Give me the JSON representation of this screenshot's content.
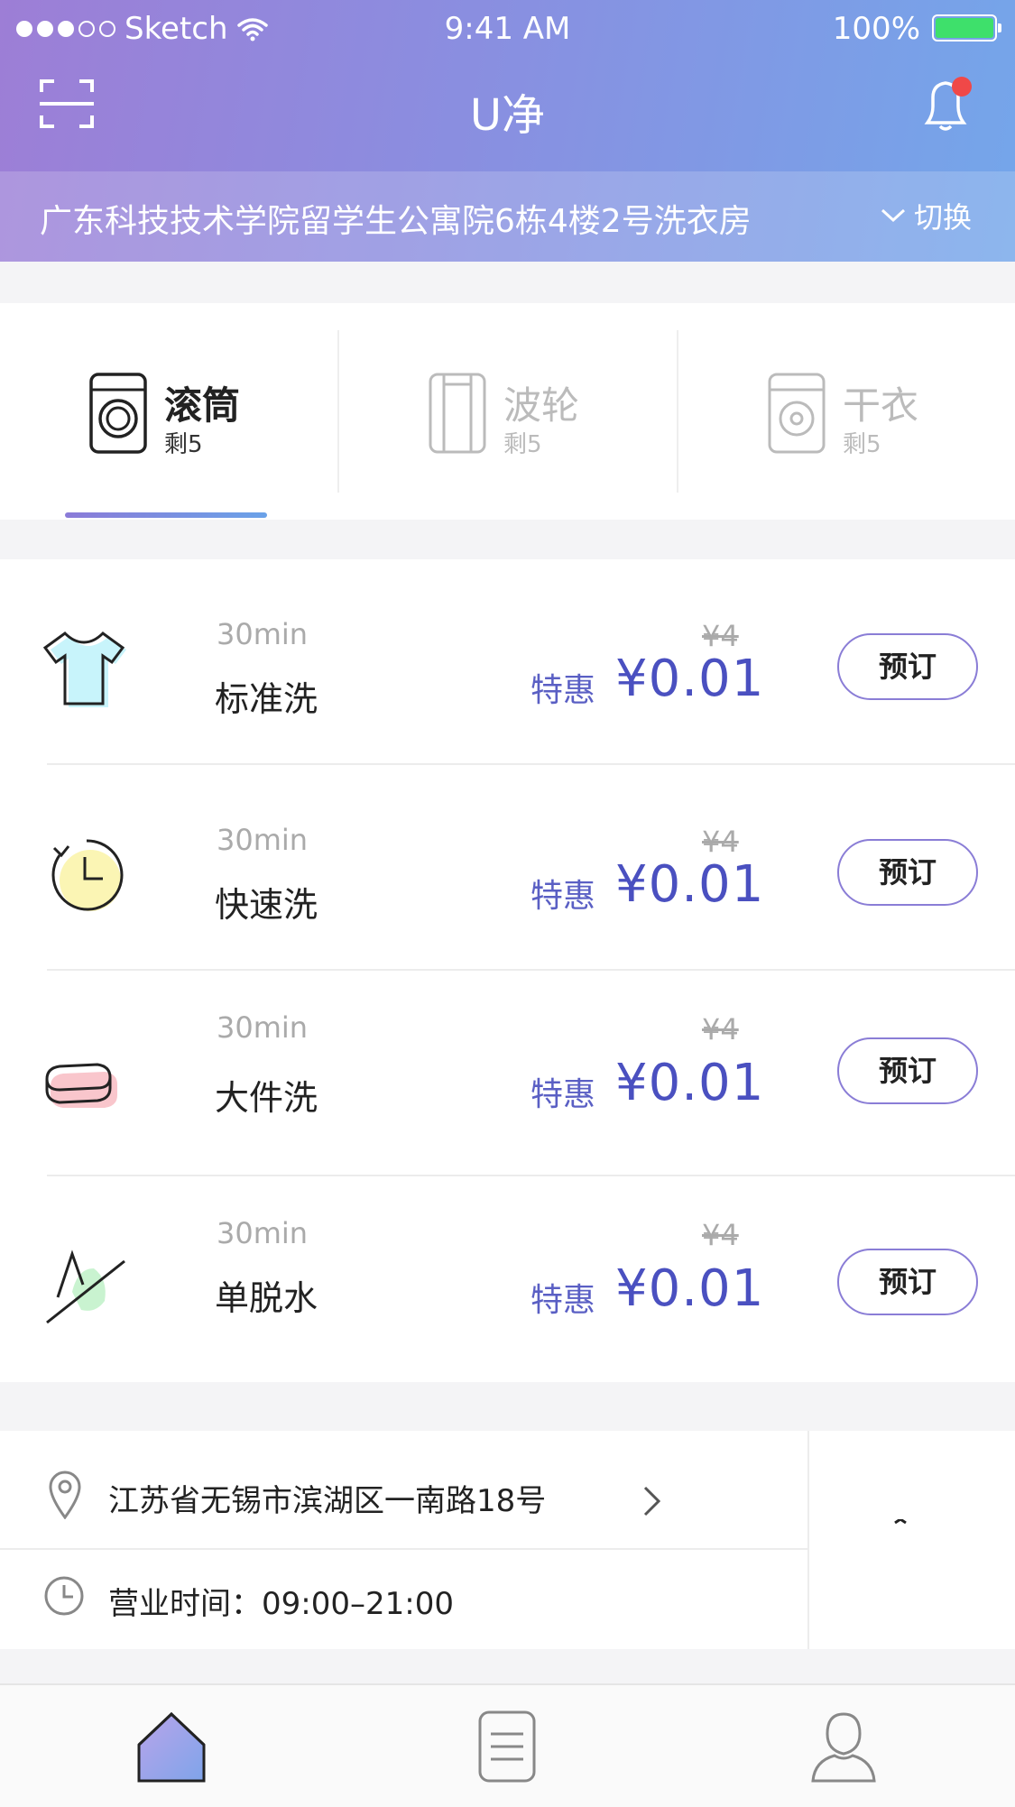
{
  "status_bar": {
    "carrier": "Sketch",
    "time": "9:41 AM",
    "battery": "100%"
  },
  "nav": {
    "title": "U净",
    "scan_icon": "scan-icon",
    "bell_icon": "bell-icon",
    "badge_color": "#f04848"
  },
  "location": {
    "address": "广东科技技术学院留学生公寓院6栋4楼2号洗衣房",
    "switch_label": "切换"
  },
  "machine_tabs": [
    {
      "name": "滚筒",
      "remaining": "剩5",
      "active": true
    },
    {
      "name": "波轮",
      "remaining": "剩5",
      "active": false
    },
    {
      "name": "干衣",
      "remaining": "剩5",
      "active": false
    }
  ],
  "services": [
    {
      "duration": "30min",
      "name": "标准洗",
      "original_price": "¥4",
      "deal_label": "特惠",
      "price": "¥0.01",
      "book_label": "预订",
      "icon": "tshirt-icon"
    },
    {
      "duration": "30min",
      "name": "快速洗",
      "original_price": "¥4",
      "deal_label": "特惠",
      "price": "¥0.01",
      "book_label": "预订",
      "icon": "timer-icon"
    },
    {
      "duration": "30min",
      "name": "大件洗",
      "original_price": "¥4",
      "deal_label": "特惠",
      "price": "¥0.01",
      "book_label": "预订",
      "icon": "blanket-icon"
    },
    {
      "duration": "30min",
      "name": "单脱水",
      "original_price": "¥4",
      "deal_label": "特惠",
      "price": "¥0.01",
      "book_label": "预订",
      "icon": "spin-dry-icon"
    }
  ],
  "store": {
    "address": "江苏省无锡市滨湖区一南路18号",
    "hours_label": "营业时间：",
    "hours_value": "09:00–21:00"
  },
  "tabbar": {
    "items": [
      "home-icon",
      "orders-icon",
      "profile-icon"
    ]
  },
  "colors": {
    "header_start": "#9d7ed6",
    "header_end": "#74a6ea",
    "accent": "#4a50c0",
    "badge": "#f04848",
    "battery": "#3ee06b"
  }
}
